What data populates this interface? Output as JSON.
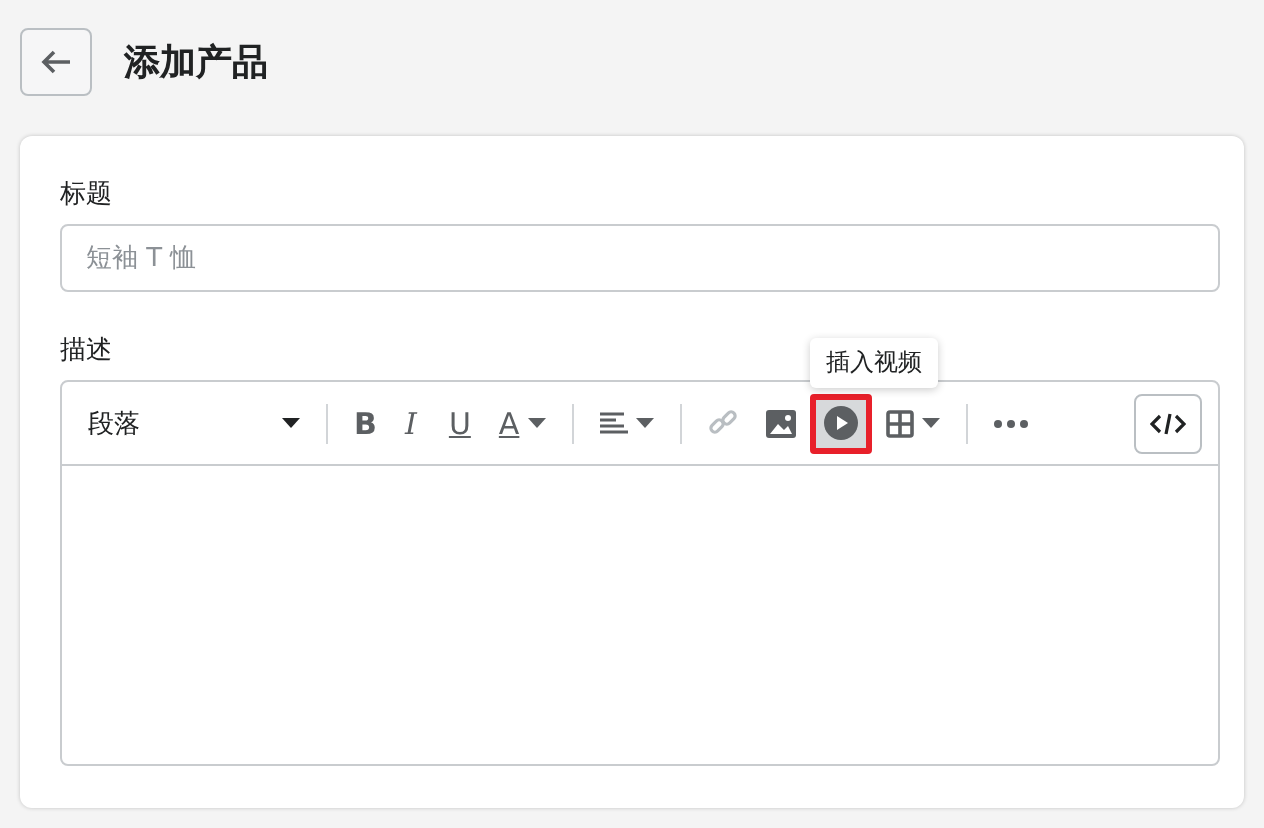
{
  "header": {
    "title": "添加产品"
  },
  "title_field": {
    "label": "标题",
    "placeholder": "短袖 T 恤"
  },
  "description": {
    "label": "描述",
    "toolbar": [
      [
        {
          "kind": "format-select",
          "label": "段落",
          "disabled": false,
          "hovered": false,
          "highlighted": false
        }
      ],
      [
        {
          "kind": "bold",
          "label": "B",
          "disabled": false,
          "hovered": false,
          "highlighted": false
        },
        {
          "kind": "italic",
          "label": "I",
          "disabled": false,
          "hovered": false,
          "highlighted": false
        },
        {
          "kind": "underline",
          "label": "U",
          "disabled": false,
          "hovered": false,
          "highlighted": false
        },
        {
          "kind": "text-color",
          "label": "A",
          "disabled": false,
          "hovered": false,
          "highlighted": false
        }
      ],
      [
        {
          "kind": "align",
          "disabled": false,
          "hovered": false,
          "highlighted": false
        }
      ],
      [
        {
          "kind": "link",
          "disabled": true,
          "hovered": false,
          "highlighted": false
        },
        {
          "kind": "image",
          "disabled": false,
          "hovered": false,
          "highlighted": false
        },
        {
          "kind": "video",
          "disabled": false,
          "hovered": true,
          "highlighted": true
        },
        {
          "kind": "table",
          "disabled": false,
          "hovered": false,
          "highlighted": false
        }
      ],
      [
        {
          "kind": "more",
          "disabled": false,
          "hovered": false,
          "highlighted": false
        }
      ]
    ],
    "code_button": {
      "disabled": false
    },
    "tooltip": "插入视频"
  }
}
